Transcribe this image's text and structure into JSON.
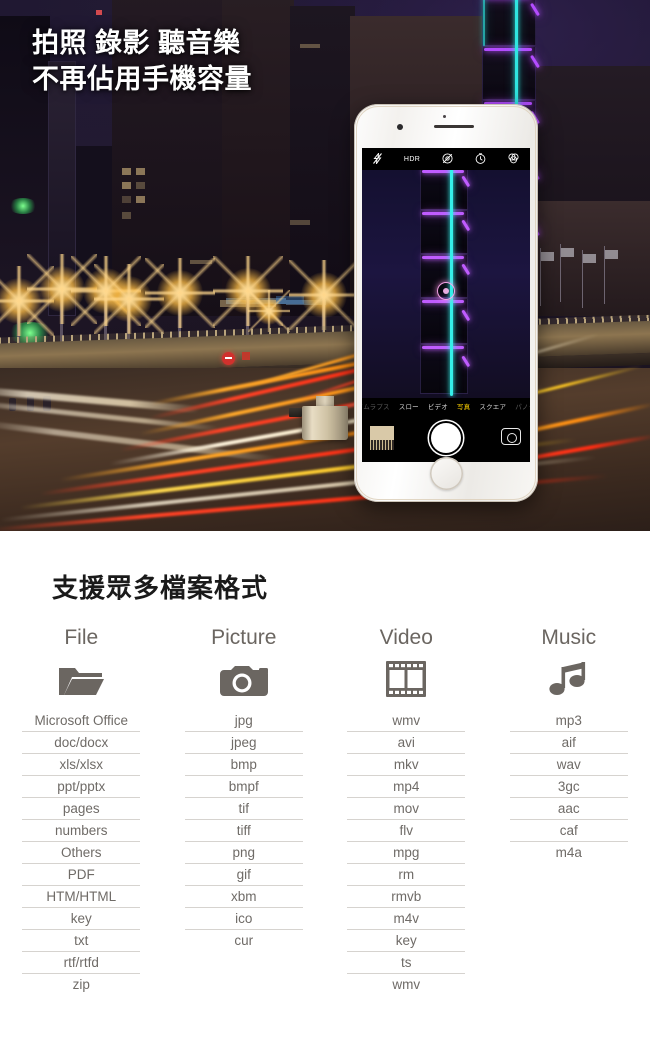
{
  "hero": {
    "headline_line1": "拍照 錄影 聽音樂",
    "headline_line2": "不再佔用手機容量",
    "headline_full": "拍照 錄影 聽音樂\n不再佔用手機容量",
    "scene": "night-cityscape-with-light-trails",
    "landmark": "Taipei 101",
    "colors": {
      "headline_text": "#ffffff",
      "sky": "#1b1430",
      "neon_purple": "#b44cff",
      "neon_cyan": "#2fe5e0",
      "trail_red": "#ff4326",
      "trail_orange": "#ffa82a",
      "trail_white": "#fff4dd",
      "lamp_glow": "#ffd78c"
    }
  },
  "phone": {
    "device": "iPhone",
    "body_color": "#f3f1ee",
    "accessory": "lightning-flash-drive",
    "accessory_color": "#cfc2a4",
    "camera_ui": {
      "top_controls": [
        {
          "name": "flash-off-icon",
          "label": ""
        },
        {
          "name": "hdr-label",
          "label": "HDR"
        },
        {
          "name": "live-photo-off-icon",
          "label": ""
        },
        {
          "name": "timer-icon",
          "label": ""
        },
        {
          "name": "filters-icon",
          "label": ""
        }
      ],
      "hdr_text": "HDR",
      "modes": [
        {
          "label": "タイムラプス",
          "active": false,
          "ghost": true
        },
        {
          "label": "スロー",
          "active": false,
          "ghost": false
        },
        {
          "label": "ビデオ",
          "active": false,
          "ghost": false
        },
        {
          "label": "写真",
          "active": true,
          "ghost": false
        },
        {
          "label": "スクエア",
          "active": false,
          "ghost": false
        },
        {
          "label": "パノラマ",
          "active": false,
          "ghost": true
        }
      ],
      "active_mode_color": "#ffd200",
      "shutter_button": "shutter",
      "thumbnail": "last-photo-thumbnail",
      "flip_button": "flip-camera"
    }
  },
  "formats": {
    "title": "支援眾多檔案格式",
    "columns": [
      {
        "heading": "File",
        "icon": "folder-icon",
        "items": [
          "Microsoft Office",
          "doc/docx",
          "xls/xlsx",
          "ppt/pptx",
          "pages",
          "numbers",
          "Others",
          "PDF",
          "HTM/HTML",
          "key",
          "txt",
          "rtf/rtfd",
          "zip"
        ]
      },
      {
        "heading": "Picture",
        "icon": "camera-icon",
        "items": [
          "jpg",
          "jpeg",
          "bmp",
          "bmpf",
          "tif",
          "tiff",
          "png",
          "gif",
          "xbm",
          "ico",
          "cur"
        ]
      },
      {
        "heading": "Video",
        "icon": "film-icon",
        "items": [
          "wmv",
          "avi",
          "mkv",
          "mp4",
          "mov",
          "flv",
          "mpg",
          "rm",
          "rmvb",
          "m4v",
          "key",
          "ts",
          "wmv"
        ]
      },
      {
        "heading": "Music",
        "icon": "music-note-icon",
        "items": [
          "mp3",
          "aif",
          "wav",
          "3gc",
          "aac",
          "caf",
          "m4a"
        ]
      }
    ],
    "colors": {
      "heading_text": "#6b6661",
      "item_text": "#6f6b67",
      "divider": "#d6d3cf",
      "title_text": "#1a1a1a",
      "icon_fill": "#6b6661"
    }
  }
}
